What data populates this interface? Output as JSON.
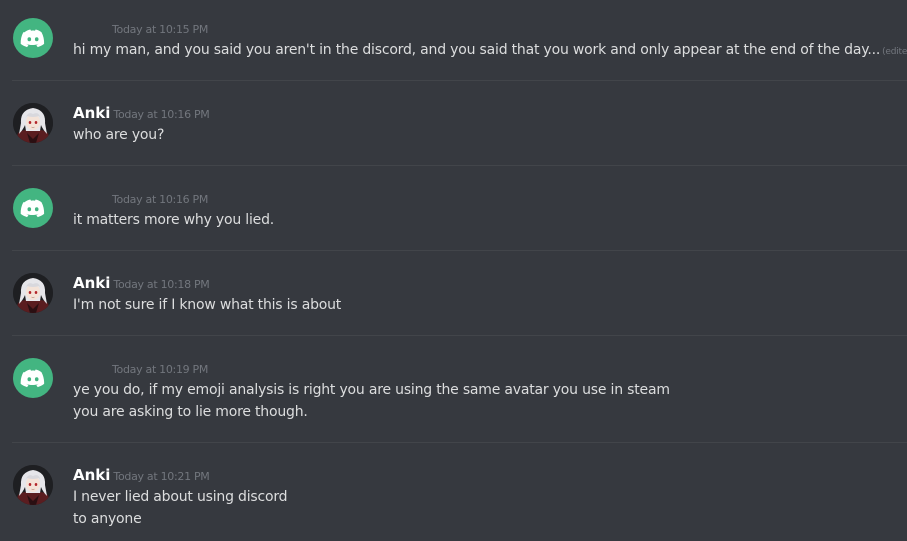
{
  "messages": [
    {
      "author": "",
      "avatar": "discord-default-icon",
      "timestamp": "Today at 10:15 PM",
      "lines": [
        "hi my man, and you said you aren't in the discord, and you said that you work and only appear at the end of the day..."
      ],
      "edited_label": "(edited)"
    },
    {
      "author": "Anki",
      "avatar": "anki-avatar",
      "timestamp": "Today at 10:16 PM",
      "lines": [
        "who are you?"
      ]
    },
    {
      "author": "",
      "avatar": "discord-default-icon",
      "timestamp": "Today at 10:16 PM",
      "lines": [
        "it matters more why you lied."
      ]
    },
    {
      "author": "Anki",
      "avatar": "anki-avatar",
      "timestamp": "Today at 10:18 PM",
      "lines": [
        "I'm not sure if I know what this is about"
      ]
    },
    {
      "author": "",
      "avatar": "discord-default-icon",
      "timestamp": "Today at 10:19 PM",
      "lines": [
        "ye you do, if my emoji analysis is right you are using the same avatar you use in steam",
        "you are asking to lie more though."
      ]
    },
    {
      "author": "Anki",
      "avatar": "anki-avatar",
      "timestamp": "Today at 10:21 PM",
      "lines": [
        "I never lied about using discord",
        "to anyone"
      ]
    }
  ],
  "colors": {
    "background": "#36393f",
    "divider": "#42454a",
    "discord_green": "#43b581",
    "text": "#dcddde",
    "timestamp": "#72767d",
    "username": "#ffffff"
  }
}
